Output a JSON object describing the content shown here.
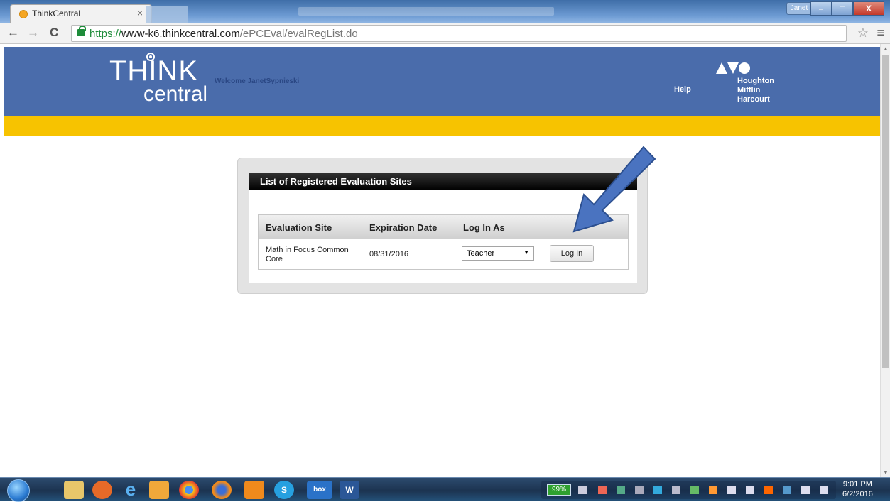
{
  "browser": {
    "tab_title": "ThinkCentral",
    "tab_close": "×",
    "user_button": "Janet",
    "url_scheme": "https://",
    "url_host": "www-k6.thinkcentral.com",
    "url_path": "/ePCEval/evalRegList.do",
    "back": "←",
    "forward": "→",
    "reload": "C",
    "star": "☆",
    "menu": "≡",
    "window_buttons": [
      "–",
      "□",
      "X"
    ]
  },
  "header": {
    "logo_think": "THINK",
    "logo_central": "central",
    "welcome": "Welcome JanetSypnieski",
    "help": "Help",
    "brand_lines": [
      "Houghton",
      "Mifflin",
      "Harcourt"
    ],
    "colors": {
      "header_bg": "#4a6cab",
      "bar": "#f7c300"
    }
  },
  "panel": {
    "title": "List of Registered Evaluation Sites",
    "columns": [
      "Evaluation Site",
      "Expiration Date",
      "Log In As"
    ],
    "rows": [
      {
        "site": "Math in Focus Common Core",
        "expiration": "08/31/2016",
        "role": "Teacher",
        "button": "Log In"
      }
    ]
  },
  "taskbar": {
    "battery": "99%",
    "time": "9:01 PM",
    "date": "6/2/2016",
    "apps": [
      "file-explorer",
      "media-player",
      "internet-explorer",
      "outlook",
      "chrome",
      "firefox",
      "app-orange",
      "skype",
      "box",
      "word"
    ],
    "app_labels": {
      "box": "box",
      "word": "W",
      "skype": "S"
    }
  }
}
